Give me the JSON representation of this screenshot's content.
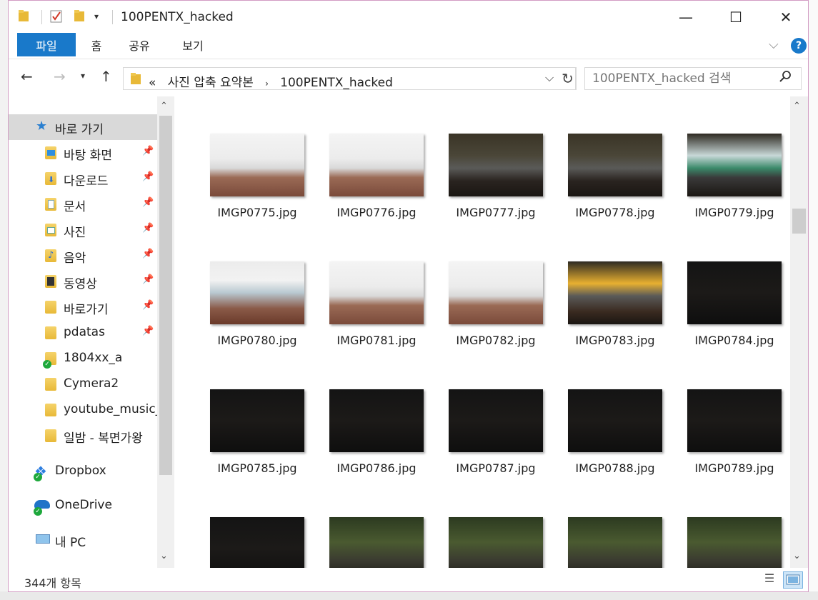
{
  "window": {
    "title": "100PENTX_hacked",
    "colors": {
      "accent": "#1979ca",
      "border": "#d29bc3"
    }
  },
  "title_buttons": {
    "minimize": "—",
    "maximize": "☐",
    "close": "✕"
  },
  "ribbon": {
    "tabs": [
      {
        "label": "파일"
      },
      {
        "label": "홈"
      },
      {
        "label": "공유"
      },
      {
        "label": "보기"
      }
    ],
    "help": "?"
  },
  "nav": {
    "path_prefix": "«",
    "path": [
      "사진 압축 요약본",
      "100PENTX_hacked"
    ],
    "search_placeholder": "100PENTX_hacked 검색"
  },
  "sidebar": {
    "items": [
      {
        "label": "바로 가기",
        "icon": "star-icon",
        "pinned": false
      },
      {
        "label": "바탕 화면",
        "icon": "desktop-folder-icon",
        "pinned": true
      },
      {
        "label": "다운로드",
        "icon": "downloads-folder-icon",
        "pinned": true
      },
      {
        "label": "문서",
        "icon": "documents-folder-icon",
        "pinned": true
      },
      {
        "label": "사진",
        "icon": "pictures-folder-icon",
        "pinned": true
      },
      {
        "label": "음악",
        "icon": "music-folder-icon",
        "pinned": true
      },
      {
        "label": "동영상",
        "icon": "videos-folder-icon",
        "pinned": true
      },
      {
        "label": "바로가기",
        "icon": "folder-icon",
        "pinned": true
      },
      {
        "label": "pdatas",
        "icon": "folder-icon",
        "pinned": true
      },
      {
        "label": "1804xx_a",
        "icon": "folder-icon",
        "pinned": false
      },
      {
        "label": "Cymera2",
        "icon": "folder-icon",
        "pinned": false
      },
      {
        "label": "youtube_music_",
        "icon": "folder-icon",
        "pinned": false
      },
      {
        "label": "일밤 - 복면가왕",
        "icon": "folder-icon",
        "pinned": false
      },
      {
        "label": "Dropbox",
        "icon": "dropbox-icon",
        "pinned": false
      },
      {
        "label": "OneDrive",
        "icon": "onedrive-icon",
        "pinned": false
      },
      {
        "label": "내 PC",
        "icon": "pc-icon",
        "pinned": false
      }
    ]
  },
  "files": [
    {
      "name": "IMGP0775.jpg",
      "kind": "bright"
    },
    {
      "name": "IMGP0776.jpg",
      "kind": "bright"
    },
    {
      "name": "IMGP0777.jpg",
      "kind": "street-dark"
    },
    {
      "name": "IMGP0778.jpg",
      "kind": "street-dark"
    },
    {
      "name": "IMGP0779.jpg",
      "kind": "bus-dark"
    },
    {
      "name": "IMGP0780.jpg",
      "kind": "bus-bright"
    },
    {
      "name": "IMGP0781.jpg",
      "kind": "bright"
    },
    {
      "name": "IMGP0782.jpg",
      "kind": "bright"
    },
    {
      "name": "IMGP0783.jpg",
      "kind": "yellow-bus"
    },
    {
      "name": "IMGP0784.jpg",
      "kind": "dark"
    },
    {
      "name": "IMGP0785.jpg",
      "kind": "dark"
    },
    {
      "name": "IMGP0786.jpg",
      "kind": "dark"
    },
    {
      "name": "IMGP0787.jpg",
      "kind": "dark"
    },
    {
      "name": "IMGP0788.jpg",
      "kind": "dark"
    },
    {
      "name": "IMGP0789.jpg",
      "kind": "dark"
    },
    {
      "name": "",
      "kind": "dark"
    },
    {
      "name": "",
      "kind": "green"
    },
    {
      "name": "",
      "kind": "green"
    },
    {
      "name": "",
      "kind": "green"
    },
    {
      "name": "",
      "kind": "green"
    }
  ],
  "status": {
    "count_text": "344개 항목"
  }
}
